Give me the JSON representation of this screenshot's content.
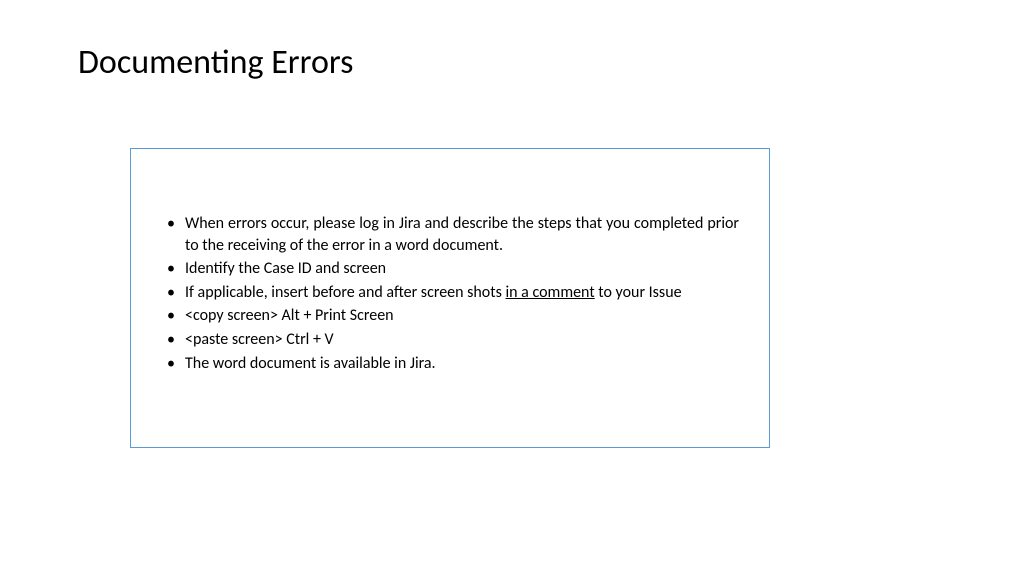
{
  "slide": {
    "title": "Documenting Errors",
    "bullets": [
      {
        "pre": "When errors occur, please log in Jira and describe the steps that you completed prior to the receiving of the error in a word document.",
        "mid": "",
        "post": ""
      },
      {
        "pre": "Identify the Case ID and screen",
        "mid": "",
        "post": ""
      },
      {
        "pre": "If applicable, insert before and after screen shots ",
        "mid": "in a comment",
        "post": " to your Issue"
      },
      {
        "pre": "<copy screen> Alt + Print Screen",
        "mid": "",
        "post": ""
      },
      {
        "pre": "<paste screen> Ctrl + V",
        "mid": "",
        "post": ""
      },
      {
        "pre": "The word document is available in Jira.",
        "mid": "",
        "post": ""
      }
    ]
  }
}
